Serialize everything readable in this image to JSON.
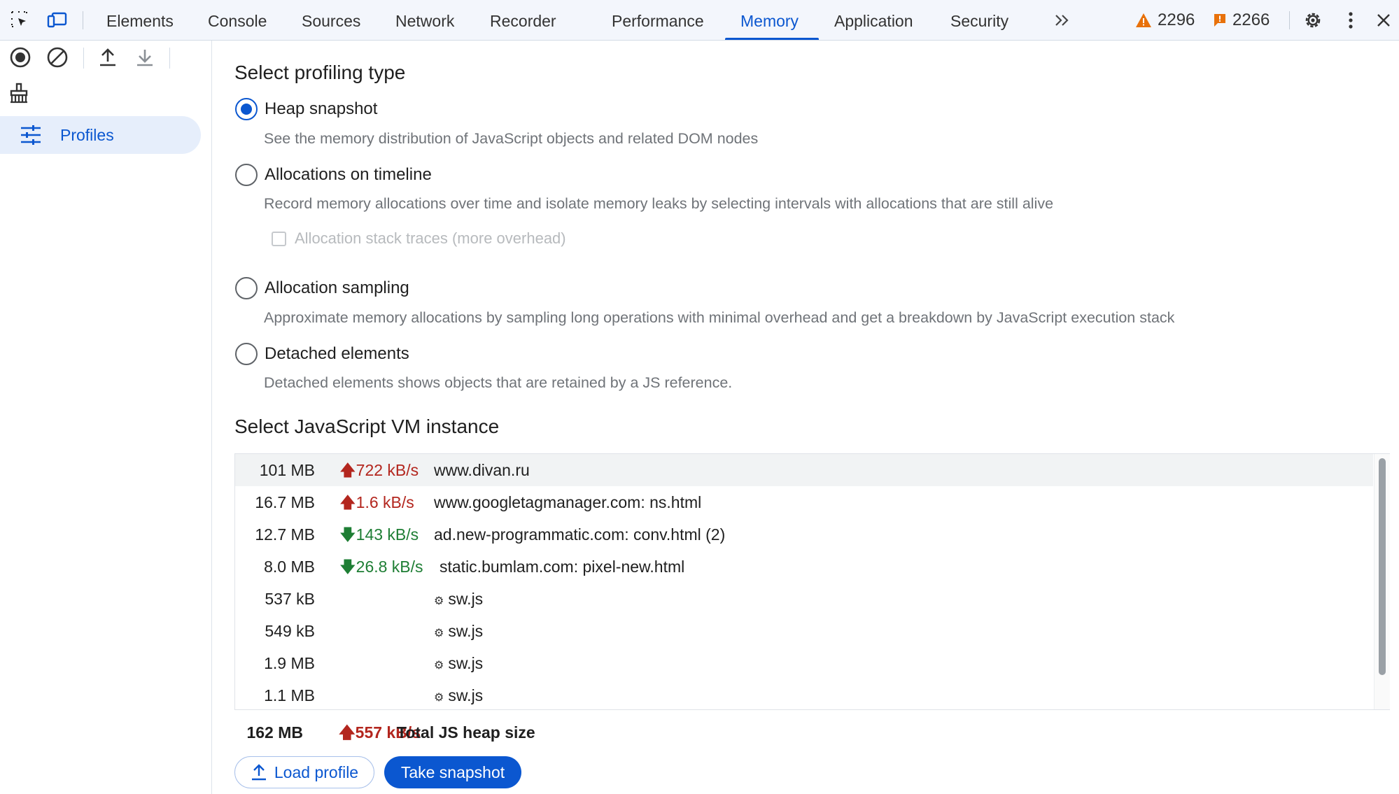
{
  "toolbar": {
    "tabs": [
      {
        "label": "Elements"
      },
      {
        "label": "Console"
      },
      {
        "label": "Sources"
      },
      {
        "label": "Network"
      },
      {
        "label": "Recorder"
      },
      {
        "label": "Performance"
      },
      {
        "label": "Memory",
        "active": true
      },
      {
        "label": "Application"
      },
      {
        "label": "Security"
      }
    ],
    "more_tabs": "»",
    "warnings_count": "2296",
    "issues_count": "2266",
    "warning_color": "#e8710a",
    "issue_color": "#e8710a"
  },
  "sidebar": {
    "profiles_label": "Profiles"
  },
  "main": {
    "profiling_heading": "Select profiling type",
    "options": [
      {
        "label": "Heap snapshot",
        "description": "See the memory distribution of JavaScript objects and related DOM nodes",
        "checked": true
      },
      {
        "label": "Allocations on timeline",
        "description": "Record memory allocations over time and isolate memory leaks by selecting intervals with allocations that are still alive",
        "checked": false
      },
      {
        "label": "Allocation sampling",
        "description": "Approximate memory allocations by sampling long operations with minimal overhead and get a breakdown by JavaScript execution stack",
        "checked": false
      },
      {
        "label": "Detached elements",
        "description": "Detached elements shows objects that are retained by a JS reference.",
        "checked": false
      }
    ],
    "stack_traces_checkbox": "Allocation stack traces (more overhead)",
    "vm_heading": "Select JavaScript VM instance",
    "vm_instances": [
      {
        "size": "101 MB",
        "rate": "722 kB/s",
        "trend": "up",
        "url": "www.divan.ru",
        "worker": false
      },
      {
        "size": "16.7 MB",
        "rate": "1.6 kB/s",
        "trend": "up",
        "url": "www.googletagmanager.com: ns.html",
        "worker": false
      },
      {
        "size": "12.7 MB",
        "rate": "143 kB/s",
        "trend": "down",
        "url": "ad.new-programmatic.com: conv.html (2)",
        "worker": false
      },
      {
        "size": "8.0 MB",
        "rate": "26.8 kB/s",
        "trend": "down",
        "url": "static.bumlam.com: pixel-new.html",
        "worker": false
      },
      {
        "size": "537 kB",
        "rate": "",
        "trend": "",
        "url": "sw.js",
        "worker": true
      },
      {
        "size": "549 kB",
        "rate": "",
        "trend": "",
        "url": "sw.js",
        "worker": true
      },
      {
        "size": "1.9 MB",
        "rate": "",
        "trend": "",
        "url": "sw.js",
        "worker": true
      },
      {
        "size": "1.1 MB",
        "rate": "",
        "trend": "",
        "url": "sw.js",
        "worker": true
      }
    ],
    "total": {
      "size": "162 MB",
      "rate": "557 kB/s",
      "label": "Total JS heap size"
    },
    "load_profile_label": "Load profile",
    "take_snapshot_label": "Take snapshot"
  },
  "colors": {
    "accent": "#0b57d0",
    "rate_up": "#b3261e",
    "rate_down": "#1e7e34"
  }
}
